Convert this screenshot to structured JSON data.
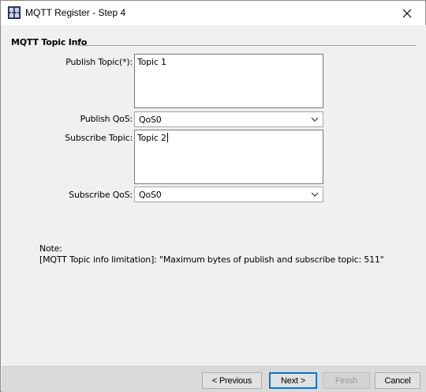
{
  "window": {
    "title": "MQTT Register - Step 4"
  },
  "section": {
    "title": "MQTT Topic Info"
  },
  "fields": {
    "publish_topic_label": "Publish Topic(*):",
    "publish_topic_value": "Topic 1",
    "publish_qos_label": "Publish QoS:",
    "publish_qos_value": "QoS0",
    "subscribe_topic_label": "Subscribe Topic:",
    "subscribe_topic_value": "Topic 2",
    "subscribe_qos_label": "Subscribe QoS:",
    "subscribe_qos_value": "QoS0"
  },
  "note": {
    "heading": "Note:",
    "text": "[MQTT Topic info limitation]: \"Maximum bytes of publish and subscribe topic: 511\""
  },
  "buttons": {
    "previous": "< Previous",
    "next": "Next >",
    "finish": "Finish",
    "cancel": "Cancel"
  },
  "icons": {
    "app": "app-icon",
    "close": "close-icon",
    "dropdown": "chevron-down-icon"
  },
  "colors": {
    "accent": "#0078d7",
    "background": "#f0f0f0",
    "footer": "#d9d9d9"
  }
}
